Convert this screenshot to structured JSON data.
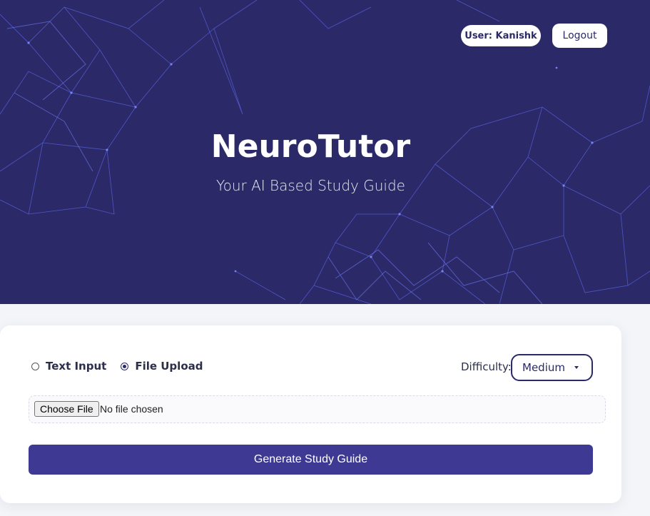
{
  "header": {
    "user_label": "User: Kanishk",
    "logout_label": "Logout",
    "title": "NeuroTutor",
    "subtitle": "Your AI Based Study Guide"
  },
  "form": {
    "input_mode": {
      "options": [
        {
          "label": "Text Input",
          "selected": false
        },
        {
          "label": "File Upload",
          "selected": true
        }
      ]
    },
    "difficulty": {
      "label": "Difficulty:",
      "value": "Medium"
    },
    "file": {
      "button_label": "Choose File",
      "status": "No file chosen"
    },
    "submit_label": "Generate Study Guide"
  },
  "colors": {
    "hero_bg": "#2b2968",
    "accent": "#3e3a94",
    "network_line": "#5b66e8"
  }
}
